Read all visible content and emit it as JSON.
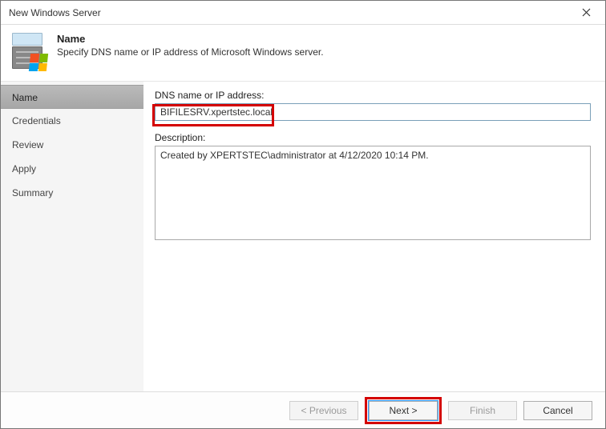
{
  "window": {
    "title": "New Windows Server"
  },
  "header": {
    "title": "Name",
    "subtitle": "Specify DNS name or IP address of Microsoft Windows server."
  },
  "sidebar": {
    "items": [
      {
        "label": "Name",
        "active": true
      },
      {
        "label": "Credentials",
        "active": false
      },
      {
        "label": "Review",
        "active": false
      },
      {
        "label": "Apply",
        "active": false
      },
      {
        "label": "Summary",
        "active": false
      }
    ]
  },
  "form": {
    "dns_label": "DNS name or IP address:",
    "dns_value": "BIFILESRV.xpertstec.local",
    "desc_label": "Description:",
    "desc_value": "Created by XPERTSTEC\\administrator at 4/12/2020 10:14 PM."
  },
  "footer": {
    "previous": "< Previous",
    "next": "Next >",
    "finish": "Finish",
    "cancel": "Cancel"
  }
}
